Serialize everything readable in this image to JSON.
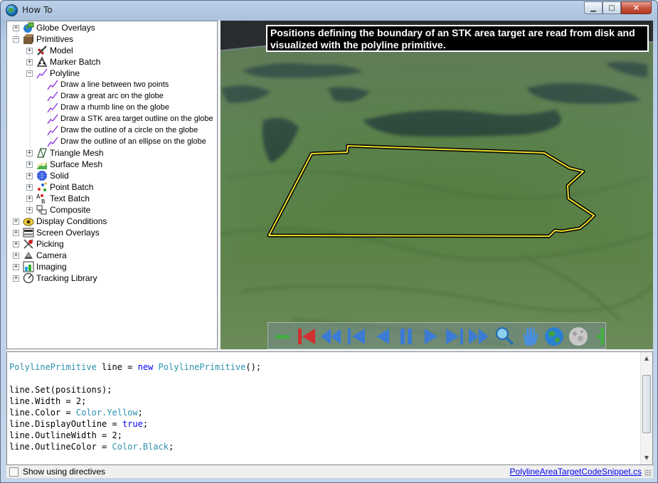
{
  "window": {
    "title": "How To",
    "icon": "globe-icon",
    "minimize_glyph": "▁",
    "maximize_glyph": "□",
    "close_glyph": "✕"
  },
  "tree": {
    "items": [
      {
        "label": "Globe Overlays",
        "icon": "globe-overlays-icon",
        "expander": "+",
        "level": 0
      },
      {
        "label": "Primitives",
        "icon": "primitives-icon",
        "expander": "−",
        "level": 0
      },
      {
        "label": "Model",
        "icon": "model-icon",
        "expander": "+",
        "level": 1
      },
      {
        "label": "Marker Batch",
        "icon": "marker-batch-icon",
        "expander": "+",
        "level": 1
      },
      {
        "label": "Polyline",
        "icon": "polyline-icon",
        "expander": "−",
        "level": 1
      },
      {
        "label": "Draw a line between two points",
        "icon": "polyline-icon",
        "expander": "",
        "level": 2
      },
      {
        "label": "Draw a great arc on the globe",
        "icon": "polyline-icon",
        "expander": "",
        "level": 2
      },
      {
        "label": "Draw a rhumb line on the globe",
        "icon": "polyline-icon",
        "expander": "",
        "level": 2
      },
      {
        "label": "Draw a STK area target outline on the globe",
        "icon": "polyline-icon",
        "expander": "",
        "level": 2
      },
      {
        "label": "Draw the outline of a circle on the globe",
        "icon": "polyline-icon",
        "expander": "",
        "level": 2
      },
      {
        "label": "Draw the outline of an ellipse on the globe",
        "icon": "polyline-icon",
        "expander": "",
        "level": 2
      },
      {
        "label": "Triangle Mesh",
        "icon": "triangle-mesh-icon",
        "expander": "+",
        "level": 1
      },
      {
        "label": "Surface Mesh",
        "icon": "surface-mesh-icon",
        "expander": "+",
        "level": 1
      },
      {
        "label": "Solid",
        "icon": "solid-icon",
        "expander": "+",
        "level": 1
      },
      {
        "label": "Point Batch",
        "icon": "point-batch-icon",
        "expander": "+",
        "level": 1
      },
      {
        "label": "Text Batch",
        "icon": "text-batch-icon",
        "expander": "+",
        "level": 1
      },
      {
        "label": "Composite",
        "icon": "composite-icon",
        "expander": "+",
        "level": 1
      },
      {
        "label": "Display Conditions",
        "icon": "display-conditions-icon",
        "expander": "+",
        "level": 0
      },
      {
        "label": "Screen Overlays",
        "icon": "screen-overlays-icon",
        "expander": "+",
        "level": 0
      },
      {
        "label": "Picking",
        "icon": "picking-icon",
        "expander": "+",
        "level": 0
      },
      {
        "label": "Camera",
        "icon": "camera-icon",
        "expander": "+",
        "level": 0
      },
      {
        "label": "Imaging",
        "icon": "imaging-icon",
        "expander": "+",
        "level": 0
      },
      {
        "label": "Tracking Library",
        "icon": "tracking-library-icon",
        "expander": "+",
        "level": 0
      }
    ]
  },
  "globe": {
    "info_text": "Positions defining the boundary of an STK area target are read from disk and visualized with the polyline primitive.",
    "outline_color": "#f0e030",
    "toolbar": [
      {
        "name": "zoom-out-button",
        "icon": "minus-icon"
      },
      {
        "name": "reset-button",
        "icon": "skip-to-start-icon"
      },
      {
        "name": "rewind-button",
        "icon": "fast-rewind-icon"
      },
      {
        "name": "step-back-button",
        "icon": "step-back-icon"
      },
      {
        "name": "play-backward-button",
        "icon": "play-backward-icon"
      },
      {
        "name": "pause-button",
        "icon": "pause-icon"
      },
      {
        "name": "play-button",
        "icon": "play-icon"
      },
      {
        "name": "step-forward-button",
        "icon": "step-forward-icon"
      },
      {
        "name": "fast-forward-button",
        "icon": "fast-forward-icon"
      },
      {
        "name": "zoom-button",
        "icon": "magnifier-icon"
      },
      {
        "name": "pan-button",
        "icon": "hand-icon"
      },
      {
        "name": "earth-button",
        "icon": "earth-icon"
      },
      {
        "name": "moon-button",
        "icon": "moon-icon"
      },
      {
        "name": "zoom-in-button",
        "icon": "plus-icon"
      }
    ]
  },
  "code": {
    "lines": [
      [
        {
          "t": "PolylinePrimitive",
          "c": "ty"
        },
        {
          "t": " line = ",
          "c": ""
        },
        {
          "t": "new",
          "c": "kw"
        },
        {
          "t": " ",
          "c": ""
        },
        {
          "t": "PolylinePrimitive",
          "c": "ty"
        },
        {
          "t": "();",
          "c": ""
        }
      ],
      [],
      [
        {
          "t": "line.Set(positions);",
          "c": ""
        }
      ],
      [
        {
          "t": "line.Width = 2;",
          "c": ""
        }
      ],
      [
        {
          "t": "line.Color = ",
          "c": ""
        },
        {
          "t": "Color.Yellow",
          "c": "ty"
        },
        {
          "t": ";",
          "c": ""
        }
      ],
      [
        {
          "t": "line.DisplayOutline = ",
          "c": ""
        },
        {
          "t": "true",
          "c": "kw"
        },
        {
          "t": ";",
          "c": ""
        }
      ],
      [
        {
          "t": "line.OutlineWidth = 2;",
          "c": ""
        }
      ],
      [
        {
          "t": "line.OutlineColor = ",
          "c": ""
        },
        {
          "t": "Color.Black",
          "c": "ty"
        },
        {
          "t": ";",
          "c": ""
        }
      ]
    ],
    "colors": {
      "keyword": "#0000ff",
      "type": "#2b91af"
    }
  },
  "bottom": {
    "checkbox_label": "Show using directives",
    "checkbox_checked": false,
    "file_link": "PolylineAreaTargetCodeSnippet.cs"
  }
}
